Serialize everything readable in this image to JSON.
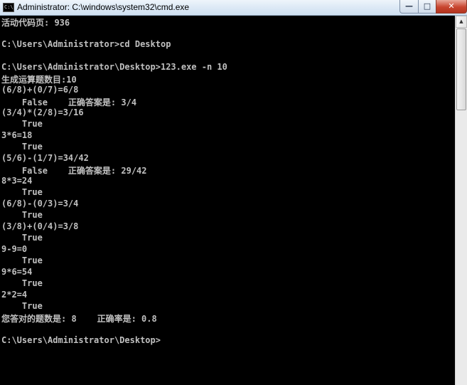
{
  "window": {
    "title": "Administrator: C:\\windows\\system32\\cmd.exe",
    "app_icon_text": "C:\\",
    "minimize_glyph": "—",
    "maximize_glyph": "□",
    "close_glyph": "✕"
  },
  "console": {
    "lines": [
      "活动代码页: 936",
      "",
      "C:\\Users\\Administrator>cd Desktop",
      "",
      "C:\\Users\\Administrator\\Desktop>123.exe -n 10",
      "生成运算题数目:10",
      "(6/8)+(0/7)=6/8",
      "    False    正确答案是: 3/4",
      "(3/4)*(2/8)=3/16",
      "    True",
      "3*6=18",
      "    True",
      "(5/6)-(1/7)=34/42",
      "    False    正确答案是: 29/42",
      "8*3=24",
      "    True",
      "(6/8)-(0/3)=3/4",
      "    True",
      "(3/8)+(0/4)=3/8",
      "    True",
      "9-9=0",
      "    True",
      "9*6=54",
      "    True",
      "2*2=4",
      "    True",
      "您答对的题数是: 8    正确率是: 0.8",
      "",
      "C:\\Users\\Administrator\\Desktop>"
    ]
  },
  "scrollbar": {
    "up_glyph": "▲"
  },
  "colors": {
    "console_bg": "#000000",
    "console_fg": "#c0c0c0",
    "close_button": "#c8452f"
  }
}
